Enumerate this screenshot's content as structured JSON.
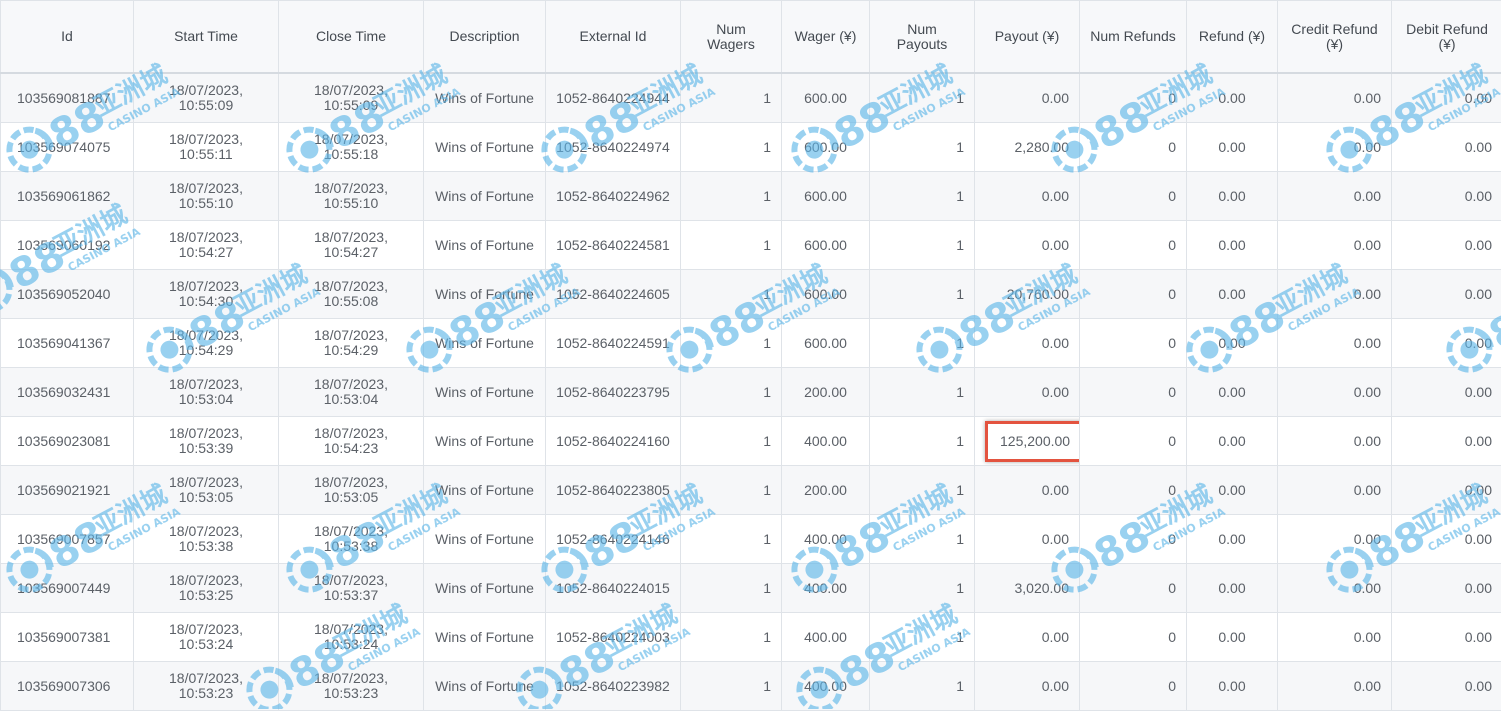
{
  "columns": [
    {
      "key": "id",
      "label": "Id"
    },
    {
      "key": "start",
      "label": "Start Time"
    },
    {
      "key": "close",
      "label": "Close Time"
    },
    {
      "key": "desc",
      "label": "Description"
    },
    {
      "key": "ext",
      "label": "External Id"
    },
    {
      "key": "num_wagers",
      "label": "Num Wagers"
    },
    {
      "key": "wager",
      "label": "Wager (¥)"
    },
    {
      "key": "num_payouts",
      "label": "Num Payouts"
    },
    {
      "key": "payout",
      "label": "Payout (¥)"
    },
    {
      "key": "num_refunds",
      "label": "Num Refunds"
    },
    {
      "key": "refund",
      "label": "Refund (¥)"
    },
    {
      "key": "credit_refund",
      "label": "Credit Refund (¥)"
    },
    {
      "key": "debit_refund",
      "label": "Debit Refund (¥)"
    }
  ],
  "rows": [
    {
      "id": "103569081887",
      "start": "18/07/2023, 10:55:09",
      "close": "18/07/2023, 10:55:09",
      "desc": "Wins of Fortune",
      "ext": "1052-8640224944",
      "num_wagers": "1",
      "wager": "600.00",
      "num_payouts": "1",
      "payout": "0.00",
      "num_refunds": "0",
      "refund": "0.00",
      "credit_refund": "0.00",
      "debit_refund": "0.00"
    },
    {
      "id": "103569074075",
      "start": "18/07/2023, 10:55:11",
      "close": "18/07/2023, 10:55:18",
      "desc": "Wins of Fortune",
      "ext": "1052-8640224974",
      "num_wagers": "1",
      "wager": "600.00",
      "num_payouts": "1",
      "payout": "2,280.00",
      "num_refunds": "0",
      "refund": "0.00",
      "credit_refund": "0.00",
      "debit_refund": "0.00"
    },
    {
      "id": "103569061862",
      "start": "18/07/2023, 10:55:10",
      "close": "18/07/2023, 10:55:10",
      "desc": "Wins of Fortune",
      "ext": "1052-8640224962",
      "num_wagers": "1",
      "wager": "600.00",
      "num_payouts": "1",
      "payout": "0.00",
      "num_refunds": "0",
      "refund": "0.00",
      "credit_refund": "0.00",
      "debit_refund": "0.00"
    },
    {
      "id": "103569060192",
      "start": "18/07/2023, 10:54:27",
      "close": "18/07/2023, 10:54:27",
      "desc": "Wins of Fortune",
      "ext": "1052-8640224581",
      "num_wagers": "1",
      "wager": "600.00",
      "num_payouts": "1",
      "payout": "0.00",
      "num_refunds": "0",
      "refund": "0.00",
      "credit_refund": "0.00",
      "debit_refund": "0.00"
    },
    {
      "id": "103569052040",
      "start": "18/07/2023, 10:54:30",
      "close": "18/07/2023, 10:55:08",
      "desc": "Wins of Fortune",
      "ext": "1052-8640224605",
      "num_wagers": "1",
      "wager": "600.00",
      "num_payouts": "1",
      "payout": "20,760.00",
      "num_refunds": "0",
      "refund": "0.00",
      "credit_refund": "0.00",
      "debit_refund": "0.00"
    },
    {
      "id": "103569041367",
      "start": "18/07/2023, 10:54:29",
      "close": "18/07/2023, 10:54:29",
      "desc": "Wins of Fortune",
      "ext": "1052-8640224591",
      "num_wagers": "1",
      "wager": "600.00",
      "num_payouts": "1",
      "payout": "0.00",
      "num_refunds": "0",
      "refund": "0.00",
      "credit_refund": "0.00",
      "debit_refund": "0.00"
    },
    {
      "id": "103569032431",
      "start": "18/07/2023, 10:53:04",
      "close": "18/07/2023, 10:53:04",
      "desc": "Wins of Fortune",
      "ext": "1052-8640223795",
      "num_wagers": "1",
      "wager": "200.00",
      "num_payouts": "1",
      "payout": "0.00",
      "num_refunds": "0",
      "refund": "0.00",
      "credit_refund": "0.00",
      "debit_refund": "0.00"
    },
    {
      "id": "103569023081",
      "start": "18/07/2023, 10:53:39",
      "close": "18/07/2023, 10:54:23",
      "desc": "Wins of Fortune",
      "ext": "1052-8640224160",
      "num_wagers": "1",
      "wager": "400.00",
      "num_payouts": "1",
      "payout": "125,200.00",
      "num_refunds": "0",
      "refund": "0.00",
      "credit_refund": "0.00",
      "debit_refund": "0.00",
      "highlight": "payout"
    },
    {
      "id": "103569021921",
      "start": "18/07/2023, 10:53:05",
      "close": "18/07/2023, 10:53:05",
      "desc": "Wins of Fortune",
      "ext": "1052-8640223805",
      "num_wagers": "1",
      "wager": "200.00",
      "num_payouts": "1",
      "payout": "0.00",
      "num_refunds": "0",
      "refund": "0.00",
      "credit_refund": "0.00",
      "debit_refund": "0.00"
    },
    {
      "id": "103569007857",
      "start": "18/07/2023, 10:53:38",
      "close": "18/07/2023, 10:53:38",
      "desc": "Wins of Fortune",
      "ext": "1052-8640224146",
      "num_wagers": "1",
      "wager": "400.00",
      "num_payouts": "1",
      "payout": "0.00",
      "num_refunds": "0",
      "refund": "0.00",
      "credit_refund": "0.00",
      "debit_refund": "0.00"
    },
    {
      "id": "103569007449",
      "start": "18/07/2023, 10:53:25",
      "close": "18/07/2023, 10:53:37",
      "desc": "Wins of Fortune",
      "ext": "1052-8640224015",
      "num_wagers": "1",
      "wager": "400.00",
      "num_payouts": "1",
      "payout": "3,020.00",
      "num_refunds": "0",
      "refund": "0.00",
      "credit_refund": "0.00",
      "debit_refund": "0.00"
    },
    {
      "id": "103569007381",
      "start": "18/07/2023, 10:53:24",
      "close": "18/07/2023, 10:53:24",
      "desc": "Wins of Fortune",
      "ext": "1052-8640224003",
      "num_wagers": "1",
      "wager": "400.00",
      "num_payouts": "1",
      "payout": "0.00",
      "num_refunds": "0",
      "refund": "0.00",
      "credit_refund": "0.00",
      "debit_refund": "0.00"
    },
    {
      "id": "103569007306",
      "start": "18/07/2023, 10:53:23",
      "close": "18/07/2023, 10:53:23",
      "desc": "Wins of Fortune",
      "ext": "1052-8640223982",
      "num_wagers": "1",
      "wager": "400.00",
      "num_payouts": "1",
      "payout": "0.00",
      "num_refunds": "0",
      "refund": "0.00",
      "credit_refund": "0.00",
      "debit_refund": "0.00"
    }
  ],
  "watermark": {
    "brand": "88",
    "cn": "亚洲城",
    "en": "CASINO ASIA",
    "color": "#5bb5e8"
  },
  "colors": {
    "highlight_border": "#e3533f",
    "header_bg": "#f7f8fa",
    "row_alt_bg": "#f6f7f9",
    "grid": "#dfe3e8"
  }
}
